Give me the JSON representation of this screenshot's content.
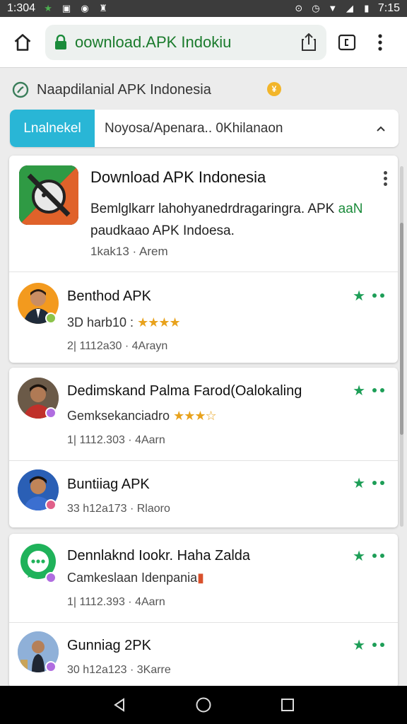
{
  "status_bar": {
    "time_left": "1:304",
    "time_right": "7:15"
  },
  "browser": {
    "url": "oownload.APK Indokiu"
  },
  "site": {
    "title": "Naapdilanial APK Indonesia"
  },
  "filter": {
    "chip": "Lnalnekel",
    "text": "Noyosa/Apenara.. 0Khilanaon"
  },
  "featured": {
    "title": "Download APK Indonesia",
    "desc_line1": "Bemlglkarr lahohyanedrdragaringra. APK",
    "desc_line1_highlight": "aaN",
    "desc_line2": "paudkaao APK Indoesa.",
    "meta": "1kak13 · Arem"
  },
  "rows": [
    {
      "title": "Benthod APK",
      "sub": "3D harb10 :",
      "stars": "★★★★",
      "meta": "2| 1112a30 · 4Arayn"
    },
    {
      "title": "Dedimskand Palma Farod(Oalokaling",
      "sub": "Gemksekanciadro",
      "stars": "★★★☆",
      "meta": "1| 1112.303 · 4Aarn"
    },
    {
      "title": "Buntiiag APK",
      "meta": "33 h12a173 · Rlaoro"
    },
    {
      "title": "Dennlaknd Iookr. Haha Zalda",
      "sub": "Camkeslaan Idenpania",
      "meta": "1| 1112.393 · 4Aarn"
    },
    {
      "title": "Gunniag 2PK",
      "meta": "30 h12a123 · 3Karre"
    }
  ],
  "colors": {
    "status_bg": "#3c3c3c",
    "url_green": "#1a7b2c",
    "chip_bg": "#29b6d6",
    "star_green": "#1d9e57",
    "star_gold": "#e8a21c"
  }
}
